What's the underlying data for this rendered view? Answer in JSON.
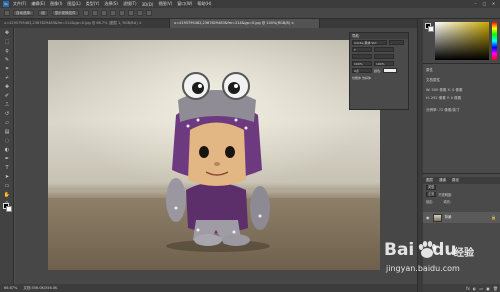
{
  "app": {
    "logo": "Ps"
  },
  "menu": {
    "items": [
      "文件(F)",
      "编辑(E)",
      "图像(I)",
      "图层(L)",
      "类型(Y)",
      "选择(S)",
      "滤镜(T)",
      "3D(D)",
      "视图(V)",
      "窗口(W)",
      "帮助(H)"
    ]
  },
  "window_controls": {
    "minimize": "–",
    "maximize": "□",
    "close": "✕"
  },
  "options_bar": {
    "items": [
      "自动选择:",
      "组",
      "显示变换控件"
    ]
  },
  "tabs": [
    {
      "label": "u=4195795462,2367829483&fm=214&gp=0.jpg @ 66.7% (图层 1, RGB/8#) ×",
      "active": false
    },
    {
      "label": "u=4195795462,2367829483&fm=214&gp=0.jpg @ 100%(RGB/8) ×",
      "active": true
    }
  ],
  "status": {
    "zoom": "66.67%",
    "doc": "文档:556.0K/556.0K"
  },
  "nav_panel": {
    "title": "导航",
    "fields": [
      "Adobe 黑体 Std",
      "-",
      "T",
      "100%",
      "100%",
      "0点",
      "颜色:"
    ],
    "footer": "仿粗体  仿斜体"
  },
  "properties": {
    "title": "属性",
    "lines": [
      "文档属性",
      "W: 500 像素    X: 0 像素",
      "H: 292 像素    Y: 0 像素",
      "分辨率: 72 像素/英寸"
    ]
  },
  "layers": {
    "tabs": [
      "图层",
      "通道",
      "路径"
    ],
    "controls": [
      "类型",
      "正常",
      "不透明度:",
      "锁定:",
      "填充:"
    ],
    "layer_name": "背景",
    "footer_icons": [
      "fx",
      "◐",
      "▭",
      "▣",
      "🗑"
    ]
  },
  "watermark": {
    "brand": "Bai",
    "brand2": "du",
    "tag": "经验",
    "url": "jingyan.baidu.com"
  },
  "colors": {
    "accent": "#2a6bb5",
    "panel_bg": "#4a4a4a",
    "canvas_bg": "#474747"
  }
}
